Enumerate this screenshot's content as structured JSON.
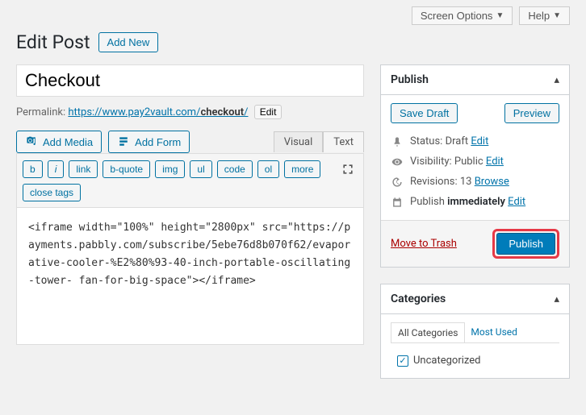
{
  "topbar": {
    "screen_options": "Screen Options",
    "help": "Help"
  },
  "header": {
    "title": "Edit Post",
    "add_new": "Add New"
  },
  "post": {
    "title": "Checkout",
    "permalink_label": "Permalink:",
    "permalink_base": "https://www.pay2vault.com/",
    "permalink_slug": "checkout",
    "edit": "Edit"
  },
  "editor": {
    "add_media": "Add Media",
    "add_form": "Add Form",
    "tab_visual": "Visual",
    "tab_text": "Text",
    "toolbar": [
      "b",
      "i",
      "link",
      "b-quote",
      "img",
      "ul",
      "code",
      "ol",
      "more",
      "close tags"
    ],
    "content": "<iframe width=\"100%\" height=\"2800px\" src=\"https://payments.pabbly.com/subscribe/5ebe76d8b070f62/evaporative-cooler-%E2%80%93-40-inch-portable-oscillating-tower- fan-for-big-space\"></iframe>"
  },
  "publish": {
    "heading": "Publish",
    "save_draft": "Save Draft",
    "preview": "Preview",
    "status_label": "Status:",
    "status_value": "Draft",
    "visibility_label": "Visibility:",
    "visibility_value": "Public",
    "revisions_label": "Revisions:",
    "revisions_count": "13",
    "browse": "Browse",
    "schedule_label": "Publish",
    "schedule_value": "immediately",
    "edit": "Edit",
    "trash": "Move to Trash",
    "submit": "Publish"
  },
  "categories": {
    "heading": "Categories",
    "tab_all": "All Categories",
    "tab_most": "Most Used",
    "items": [
      "Uncategorized"
    ]
  }
}
